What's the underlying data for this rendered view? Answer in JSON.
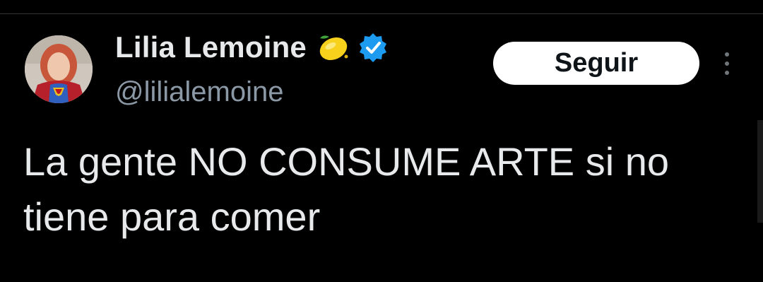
{
  "tweet": {
    "author": {
      "display_name": "Lilia Lemoine",
      "handle": "@lilialemoine",
      "name_emoji": "lemon-icon",
      "badge": "verified-icon",
      "badge_color": "#1d9bf0"
    },
    "follow_label": "Seguir",
    "more_icon": "more-vertical-icon",
    "text": "La gente NO CONSUME ARTE si no tiene para comer"
  },
  "colors": {
    "background": "#000000",
    "primary_text": "#e7e9ea",
    "secondary_text": "#8b98a5",
    "button_bg": "#ffffff",
    "button_text": "#0f1419"
  }
}
